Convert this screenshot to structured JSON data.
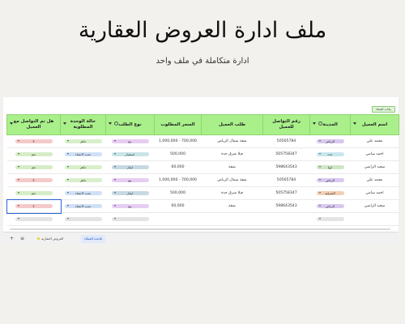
{
  "hero": {
    "title": "ملف ادارة العروض العقارية",
    "subtitle": "ادارة متكاملة في ملف واحد"
  },
  "sheet": {
    "tag_label": "بيانات العملاء",
    "columns": [
      {
        "label": "اسم العميل",
        "icon": "chevron-down-icon"
      },
      {
        "label": "المدينة",
        "icon": "chevron-down-icon"
      },
      {
        "label": "رقم التواصل للعميل",
        "icon": ""
      },
      {
        "label": "طلب العميل",
        "icon": ""
      },
      {
        "label": "السعر المطلوب",
        "icon": ""
      },
      {
        "label": "نوع الطلب",
        "icon": "chevron-down-icon"
      },
      {
        "label": "حالة الوحدة المطلوبة",
        "icon": "chevron-down-icon"
      },
      {
        "label": "هل تم التواصل مع العميل",
        "icon": "chevron-down-icon"
      }
    ],
    "rows": [
      {
        "name": "محمد علي",
        "city": "الرياض",
        "city_color": "#d9c8f0",
        "phone": "50565784",
        "request": "شقة شمال الرياض",
        "price": "700,000 - 1,000,000",
        "type": "بيع",
        "type_color": "#e6cdf2",
        "status": "جاهز",
        "status_color": "#d8efcb",
        "contacted": "لا",
        "contacted_color": "#f6c9c9"
      },
      {
        "name": "احمد سامي",
        "city": "جدة",
        "city_color": "#c7e8ef",
        "phone": "505758347",
        "request": "فيلا شرق جدة",
        "price": "500,000",
        "type": "استثمار",
        "type_color": "#c8e4e6",
        "status": "تحت الانشاء",
        "status_color": "#cfe0f6",
        "contacted": "نعم",
        "contacted_color": "#d5edc6"
      },
      {
        "name": "سعيد الراضي",
        "city": "ابها",
        "city_color": "#cfe6c4",
        "phone": "598643543",
        "request": "شقة",
        "price": "60,000",
        "type": "ايجار",
        "type_color": "#c6d9e2",
        "status": "جاهز",
        "status_color": "#d8efcb",
        "contacted": "نعم",
        "contacted_color": "#d5edc6"
      },
      {
        "name": "محمد علي",
        "city": "الرياض",
        "city_color": "#d9c8f0",
        "phone": "50565784",
        "request": "شقة شمال الرياض",
        "price": "700,000 - 1,000,000",
        "type": "بيع",
        "type_color": "#e6cdf2",
        "status": "جاهز",
        "status_color": "#d8efcb",
        "contacted": "لا",
        "contacted_color": "#f6c9c9"
      },
      {
        "name": "احمد سامي",
        "city": "الشرقية",
        "city_color": "#f4cfb4",
        "phone": "505758347",
        "request": "فيلا شرق جدة",
        "price": "500,000",
        "type": "ايجار",
        "type_color": "#c6d9e2",
        "status": "تحت الانشاء",
        "status_color": "#cfe0f6",
        "contacted": "نعم",
        "contacted_color": "#d5edc6"
      },
      {
        "name": "سعيد الراضي",
        "city": "الرياض",
        "city_color": "#d9c8f0",
        "phone": "598643543",
        "request": "شقة",
        "price": "60,000",
        "type": "بيع",
        "type_color": "#e6cdf2",
        "status": "تحت الانشاء",
        "status_color": "#cfe0f6",
        "contacted": "لا",
        "contacted_color": "#f6c9c9"
      }
    ]
  },
  "tabs": {
    "add_label": "+",
    "menu_label": "≡",
    "items": [
      {
        "label": "العروض العقارية",
        "active": false,
        "marker_color": "#f1d54a"
      },
      {
        "label": "قاعدة العملاء",
        "active": true,
        "marker_color": ""
      }
    ]
  }
}
